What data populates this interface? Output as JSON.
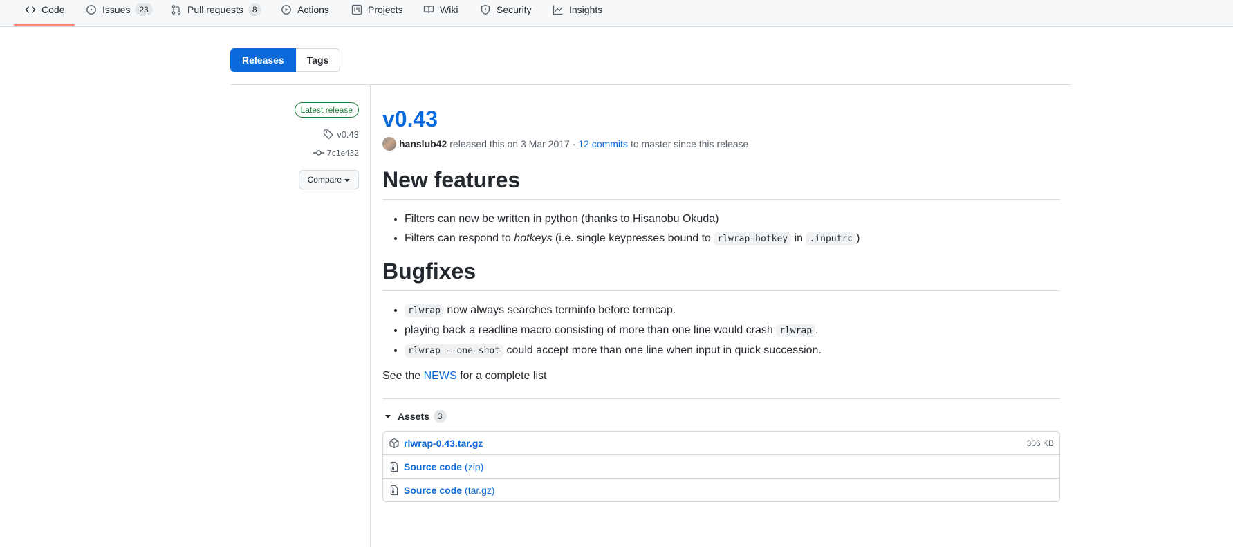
{
  "nav": {
    "code": "Code",
    "issues": "Issues",
    "issues_count": "23",
    "pulls": "Pull requests",
    "pulls_count": "8",
    "actions": "Actions",
    "projects": "Projects",
    "wiki": "Wiki",
    "security": "Security",
    "insights": "Insights"
  },
  "subnav": {
    "releases": "Releases",
    "tags": "Tags"
  },
  "sidebar": {
    "latest": "Latest release",
    "tag": "v0.43",
    "commit": "7c1e432",
    "compare": "Compare"
  },
  "release": {
    "title": "v0.43",
    "author": "hanslub42",
    "released_text": "released this on 3 Mar 2017 ·",
    "commits_link": "12 commits",
    "commits_suffix": "to master since this release",
    "features_heading": "New features",
    "feature1": "Filters can now be written in python (thanks to Hisanobu Okuda)",
    "feature2_pre": "Filters can respond to",
    "feature2_em": "hotkeys",
    "feature2_mid": "(i.e. single keypresses bound to",
    "feature2_code1": "rlwrap-hotkey",
    "feature2_in": "in",
    "feature2_code2": ".inputrc",
    "feature2_end": ")",
    "bugfixes_heading": "Bugfixes",
    "bug1_code": "rlwrap",
    "bug1_text": "now always searches terminfo before termcap.",
    "bug2_text": "playing back a readline macro consisting of more than one line would crash",
    "bug2_code": "rlwrap",
    "bug2_end": ".",
    "bug3_code": "rlwrap --one-shot",
    "bug3_text": "could accept more than one line when input in quick succession.",
    "see_pre": "See the",
    "see_link": "NEWS",
    "see_post": "for a complete list"
  },
  "assets": {
    "label": "Assets",
    "count": "3",
    "items": [
      {
        "name": "rlwrap-0.43.tar.gz",
        "size": "306 KB"
      },
      {
        "name": "Source code",
        "ext": "(zip)"
      },
      {
        "name": "Source code",
        "ext": "(tar.gz)"
      }
    ]
  },
  "colors": {
    "accent": "#0969da",
    "nav_underline": "#fd8c73",
    "latest_green": "#1a7f37"
  }
}
